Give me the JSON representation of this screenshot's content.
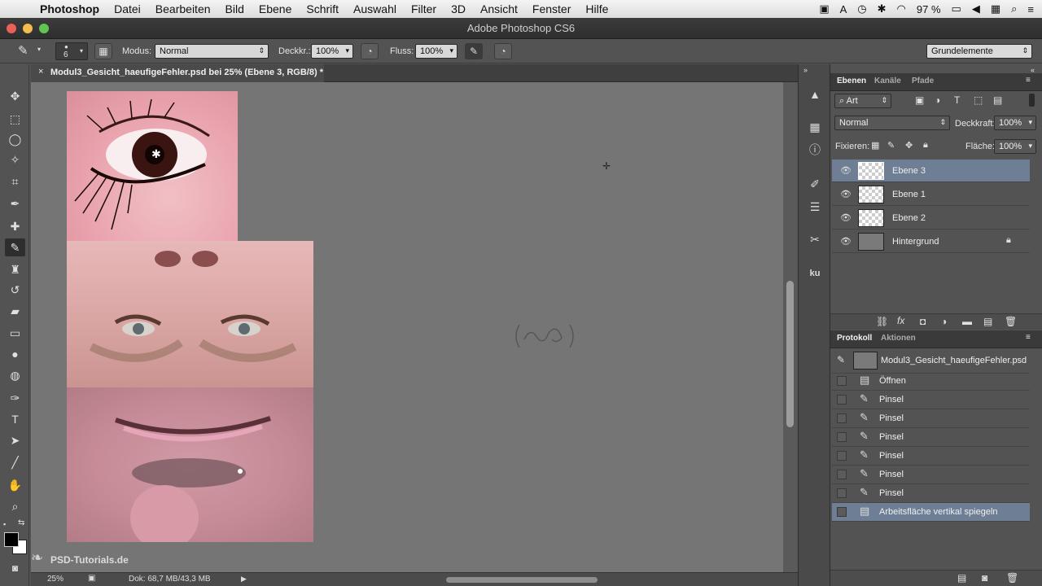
{
  "menubar": {
    "app": "Photoshop",
    "items": [
      "Datei",
      "Bearbeiten",
      "Bild",
      "Ebene",
      "Schrift",
      "Auswahl",
      "Filter",
      "3D",
      "Ansicht",
      "Fenster",
      "Hilfe"
    ],
    "battery": "97 %"
  },
  "window": {
    "title": "Adobe Photoshop CS6"
  },
  "options": {
    "brush_size": "6",
    "modus_label": "Modus:",
    "modus_value": "Normal",
    "deckkr_label": "Deckkr.:",
    "deckkr_value": "100%",
    "fluss_label": "Fluss:",
    "fluss_value": "100%",
    "workspace": "Grundelemente"
  },
  "document": {
    "tab_title": "Modul3_Gesicht_haeufigeFehler.psd bei 25% (Ebene 3, RGB/8) *"
  },
  "status": {
    "zoom": "25%",
    "doc_size": "Dok: 68,7 MB/43,3 MB"
  },
  "layers_panel": {
    "tabs": [
      "Ebenen",
      "Kanäle",
      "Pfade"
    ],
    "filter_label": "Art",
    "blend_mode": "Normal",
    "opacity_label": "Deckkraft:",
    "opacity_value": "100%",
    "lock_label": "Fixieren:",
    "fill_label": "Fläche:",
    "fill_value": "100%",
    "layers": [
      {
        "name": "Ebene 3",
        "selected": true
      },
      {
        "name": "Ebene 1",
        "selected": false
      },
      {
        "name": "Ebene 2",
        "selected": false
      },
      {
        "name": "Hintergrund",
        "selected": false,
        "locked": true
      }
    ]
  },
  "history_panel": {
    "tabs": [
      "Protokoll",
      "Aktionen"
    ],
    "snapshot": "Modul3_Gesicht_haeufigeFehler.psd",
    "steps": [
      "Öffnen",
      "Pinsel",
      "Pinsel",
      "Pinsel",
      "Pinsel",
      "Pinsel",
      "Pinsel",
      "Arbeitsfläche vertikal spiegeln"
    ]
  },
  "watermark": "PSD-Tutorials.de",
  "colors": {
    "selection": "#6d7e95",
    "canvas": "#757575",
    "panel": "#535353"
  }
}
